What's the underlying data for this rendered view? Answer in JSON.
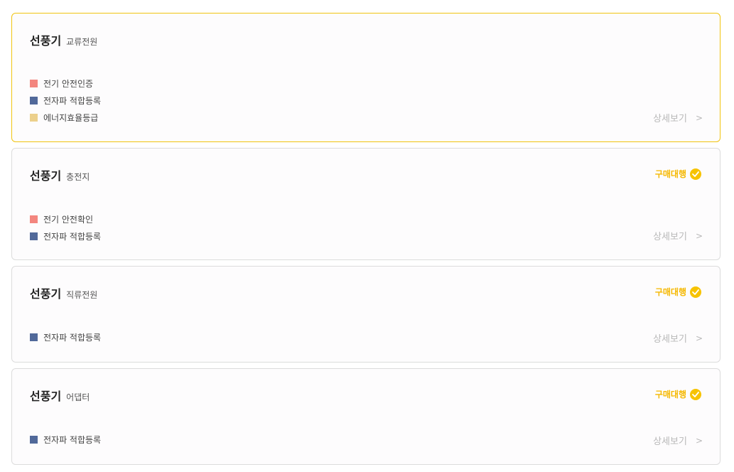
{
  "cards": [
    {
      "title": "선풍기",
      "subtitle": "교류전원",
      "badge": "",
      "certs": [
        {
          "label": "전기 안전인증",
          "color": "#f3867f"
        },
        {
          "label": "전자파 적합등록",
          "color": "#51699a"
        },
        {
          "label": "에너지효율등급",
          "color": "#ecd08c"
        }
      ],
      "detail_label": "상세보기",
      "detail_chevron": ">"
    },
    {
      "title": "선풍기",
      "subtitle": "충전지",
      "badge": "구매대행",
      "certs": [
        {
          "label": "전기 안전확인",
          "color": "#f3867f"
        },
        {
          "label": "전자파 적합등록",
          "color": "#51699a"
        }
      ],
      "detail_label": "상세보기",
      "detail_chevron": ">"
    },
    {
      "title": "선풍기",
      "subtitle": "직류전원",
      "badge": "구매대행",
      "certs": [
        {
          "label": "전자파 적합등록",
          "color": "#51699a"
        }
      ],
      "detail_label": "상세보기",
      "detail_chevron": ">"
    },
    {
      "title": "선풍기",
      "subtitle": "어댑터",
      "badge": "구매대행",
      "certs": [
        {
          "label": "전자파 적합등록",
          "color": "#51699a"
        }
      ],
      "detail_label": "상세보기",
      "detail_chevron": ">"
    }
  ],
  "colors": {
    "selected_border": "#f1c40f",
    "badge_text": "#f5b800",
    "badge_check": "#f7c300"
  }
}
